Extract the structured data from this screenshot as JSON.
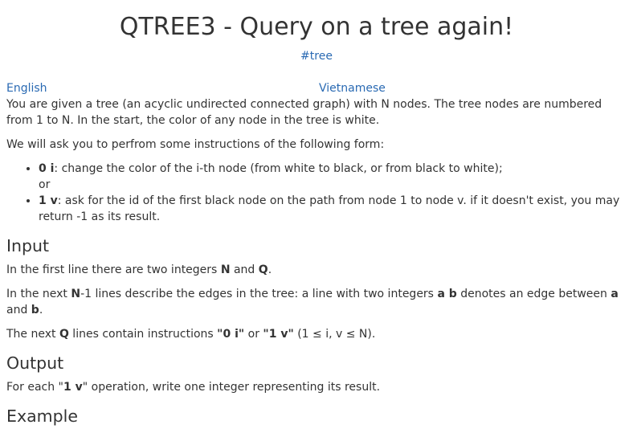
{
  "title": "QTREE3 - Query on a tree again!",
  "tag": "#tree",
  "languages": {
    "english": "English",
    "vietnamese": "Vietnamese"
  },
  "intro": {
    "p1": "You are given a tree (an acyclic undirected connected graph) with N nodes. The tree nodes are numbered from 1 to N. In the start, the color of any node in the tree is white.",
    "p2": "We will ask you to perfrom some instructions of the following form:"
  },
  "instructions": [
    {
      "code": "0 i",
      "text": ": change the color of the i-th node (from white to black, or from black to white);"
    },
    {
      "code": "1 v",
      "text": ": ask for the id of the first black node on the path from node 1 to node v. if it doesn't exist, you may return -1 as its result."
    }
  ],
  "or_text": "or",
  "input": {
    "heading": "Input",
    "line1": {
      "pre": "In the first line there are two integers ",
      "n": "N",
      "and": " and ",
      "q": "Q",
      "end": "."
    },
    "line2": {
      "pre": "In the next ",
      "n": "N",
      "mid": "-1 lines describe the edges in the tree: a line with two integers ",
      "ab": "a b",
      "mid2": " denotes an edge between ",
      "a": "a",
      "and": " and ",
      "b": "b",
      "end": "."
    },
    "line3": {
      "pre": "The next ",
      "q": "Q",
      "mid": " lines contain instructions ",
      "i0": "\"0 i\"",
      "or": " or ",
      "i1": "\"1 v\"",
      "end": " (1 ≤ i, v ≤ N)."
    }
  },
  "output": {
    "heading": "Output",
    "pre": "For each \"",
    "code": "1 v",
    "end": "\" operation, write one integer representing its result."
  },
  "example": {
    "heading": "Example"
  }
}
